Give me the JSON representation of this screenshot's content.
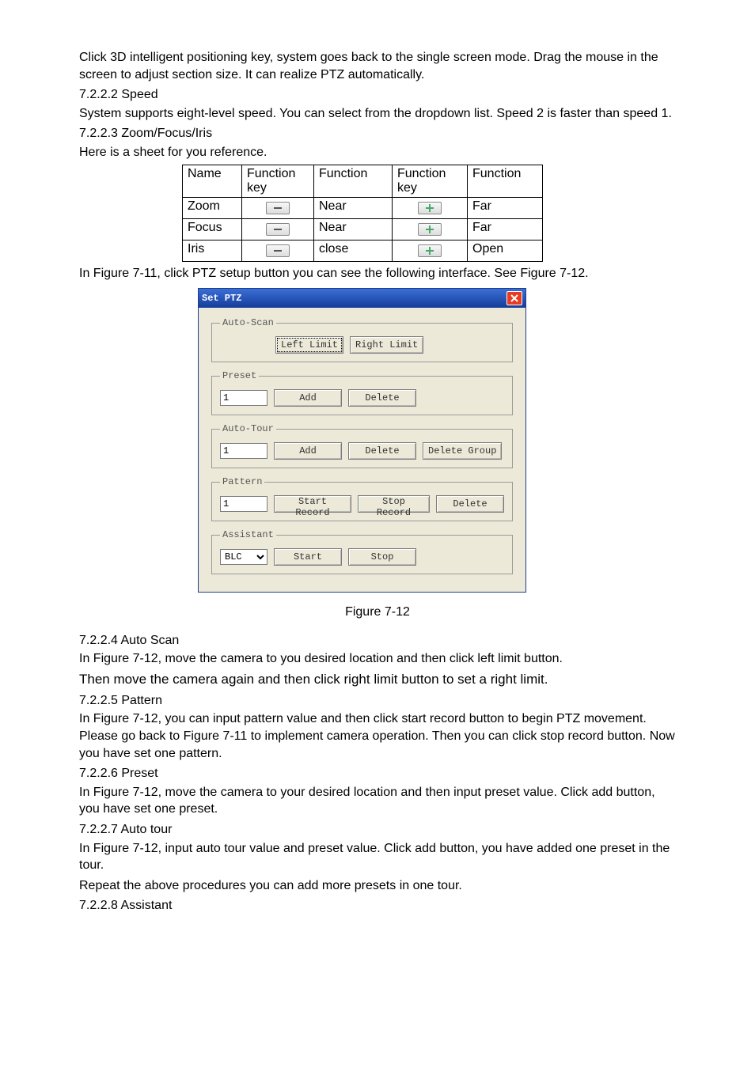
{
  "intro": {
    "p1": "Click 3D intelligent positioning key, system goes back to the single screen mode. Drag the mouse in the screen to adjust section size. It can realize PTZ automatically."
  },
  "sec_7_2_2_2": {
    "heading": "7.2.2.2  Speed",
    "p1": "System supports eight-level speed. You can select from the dropdown list. Speed 2 is faster than speed 1."
  },
  "sec_7_2_2_3": {
    "heading": "7.2.2.3  Zoom/Focus/Iris",
    "p1": "Here is a sheet for you reference.",
    "table": {
      "h_name": "Name",
      "h_fkey1": "Function key",
      "h_func1": "Function",
      "h_fkey2": "Function key",
      "h_func2": "Function",
      "rows": [
        {
          "name": "Zoom",
          "f1": "Near",
          "f2": "Far"
        },
        {
          "name": "Focus",
          "f1": "Near",
          "f2": "Far"
        },
        {
          "name": "Iris",
          "f1": "close",
          "f2": "Open"
        }
      ]
    },
    "after_table": "In Figure 7-11, click PTZ setup button you can see the following interface. See Figure 7-12."
  },
  "dialog": {
    "title": "Set PTZ",
    "autoscan": {
      "legend": "Auto-Scan",
      "left": "Left Limit",
      "right": "Right Limit"
    },
    "preset": {
      "legend": "Preset",
      "value": "1",
      "add": "Add",
      "delete": "Delete"
    },
    "autotour": {
      "legend": "Auto-Tour",
      "value": "1",
      "add": "Add",
      "delete": "Delete",
      "delgrp": "Delete Group"
    },
    "pattern": {
      "legend": "Pattern",
      "value": "1",
      "start": "Start Record",
      "stop": "Stop Record",
      "delete": "Delete"
    },
    "assistant": {
      "legend": "Assistant",
      "value": "BLC",
      "start": "Start",
      "stop": "Stop"
    }
  },
  "fig712": "Figure 7-12",
  "sec_7_2_2_4": {
    "heading": "7.2.2.4  Auto Scan",
    "p1": "In Figure 7-12, move the camera to you desired location and then click left limit button.",
    "p2": "Then move the camera again and then click right limit button to set a right limit."
  },
  "sec_7_2_2_5": {
    "heading": "7.2.2.5  Pattern",
    "p1": "In Figure 7-12, you can input pattern value and then click start record button to begin PTZ movement. Please go back to Figure 7-11 to implement camera operation. Then you can click stop record button. Now you have set one pattern."
  },
  "sec_7_2_2_6": {
    "heading": "7.2.2.6  Preset",
    "p1": "In Figure 7-12, move the camera to your desired location and then input preset value. Click add button, you have set one preset."
  },
  "sec_7_2_2_7": {
    "heading": "7.2.2.7  Auto tour",
    "p1": "In Figure 7-12, input auto tour value and preset value. Click add button, you have added one preset in the tour.",
    "p2": "Repeat the above procedures you can add more presets in one tour."
  },
  "sec_7_2_2_8": {
    "heading": "7.2.2.8  Assistant"
  }
}
